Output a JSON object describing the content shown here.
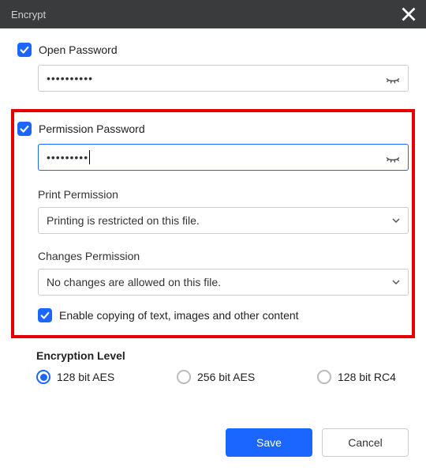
{
  "titlebar": {
    "title": "Encrypt"
  },
  "open_password": {
    "label": "Open Password",
    "masked_value": "••••••••••"
  },
  "permission_password": {
    "label": "Permission Password",
    "masked_value": "•••••••••"
  },
  "print_permission": {
    "label": "Print Permission",
    "selected": "Printing is restricted on this file."
  },
  "changes_permission": {
    "label": "Changes Permission",
    "selected": "No changes are allowed on this file."
  },
  "enable_copy": {
    "label": "Enable copying of text, images and other content"
  },
  "encryption_level": {
    "title": "Encryption Level",
    "options": [
      "128 bit AES",
      "256 bit AES",
      "128 bit RC4"
    ],
    "selected_index": 0
  },
  "footer": {
    "save": "Save",
    "cancel": "Cancel"
  },
  "colors": {
    "accent": "#1a66ff",
    "highlight": "#e60000"
  }
}
